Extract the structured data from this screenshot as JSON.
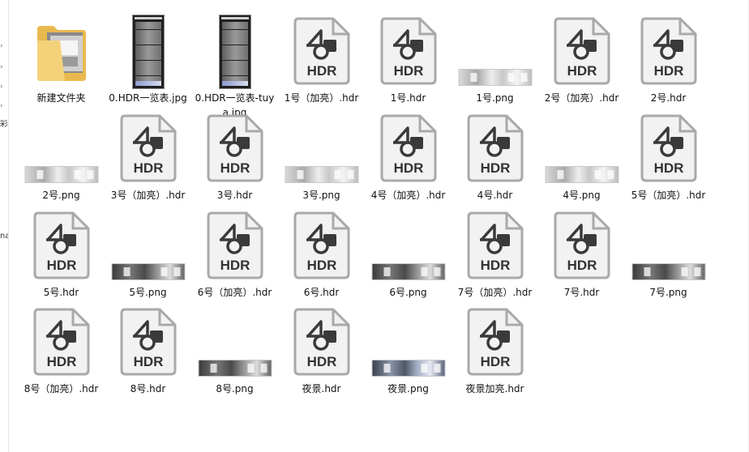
{
  "gutter": {
    "arrows": [
      "›",
      "›",
      "›",
      "›"
    ],
    "texts": [
      "彩",
      "na"
    ]
  },
  "rows": [
    [
      {
        "kind": "folder",
        "label": "新建文件夹"
      },
      {
        "kind": "jpg",
        "label": "0.HDR一览表.jpg"
      },
      {
        "kind": "jpg",
        "label": "0.HDR一览表-tuya.jpg"
      },
      {
        "kind": "hdr",
        "label": "1号（加亮）.hdr",
        "icon_text": "HDR"
      },
      {
        "kind": "hdr",
        "label": "1号.hdr",
        "icon_text": "HDR"
      },
      {
        "kind": "png",
        "tone": "light",
        "label": "1号.png"
      },
      {
        "kind": "hdr",
        "label": "2号（加亮）.hdr",
        "icon_text": "HDR"
      },
      {
        "kind": "hdr",
        "label": "2号.hdr",
        "icon_text": "HDR"
      }
    ],
    [
      {
        "kind": "png",
        "tone": "light",
        "label": "2号.png"
      },
      {
        "kind": "hdr",
        "label": "3号（加亮）.hdr",
        "icon_text": "HDR"
      },
      {
        "kind": "hdr",
        "label": "3号.hdr",
        "icon_text": "HDR"
      },
      {
        "kind": "png",
        "tone": "light",
        "label": "3号.png"
      },
      {
        "kind": "hdr",
        "label": "4号（加亮）.hdr",
        "icon_text": "HDR"
      },
      {
        "kind": "hdr",
        "label": "4号.hdr",
        "icon_text": "HDR"
      },
      {
        "kind": "png",
        "tone": "light",
        "label": "4号.png"
      },
      {
        "kind": "hdr",
        "label": "5号（加亮）.hdr",
        "icon_text": "HDR"
      }
    ],
    [
      {
        "kind": "hdr",
        "label": "5号.hdr",
        "icon_text": "HDR"
      },
      {
        "kind": "png",
        "tone": "dark",
        "label": "5号.png"
      },
      {
        "kind": "hdr",
        "label": "6号（加亮）.hdr",
        "icon_text": "HDR"
      },
      {
        "kind": "hdr",
        "label": "6号.hdr",
        "icon_text": "HDR"
      },
      {
        "kind": "png",
        "tone": "dark",
        "label": "6号.png"
      },
      {
        "kind": "hdr",
        "label": "7号（加亮）.hdr",
        "icon_text": "HDR"
      },
      {
        "kind": "hdr",
        "label": "7号.hdr",
        "icon_text": "HDR"
      },
      {
        "kind": "png",
        "tone": "dark",
        "label": "7号.png"
      }
    ],
    [
      {
        "kind": "hdr",
        "label": "8号（加亮）.hdr",
        "icon_text": "HDR"
      },
      {
        "kind": "hdr",
        "label": "8号.hdr",
        "icon_text": "HDR"
      },
      {
        "kind": "png",
        "tone": "dark",
        "label": "8号.png"
      },
      {
        "kind": "hdr",
        "label": "夜景.hdr",
        "icon_text": "HDR"
      },
      {
        "kind": "png",
        "tone": "night",
        "label": "夜景.png"
      },
      {
        "kind": "hdr",
        "label": "夜景加亮.hdr",
        "icon_text": "HDR"
      }
    ]
  ]
}
